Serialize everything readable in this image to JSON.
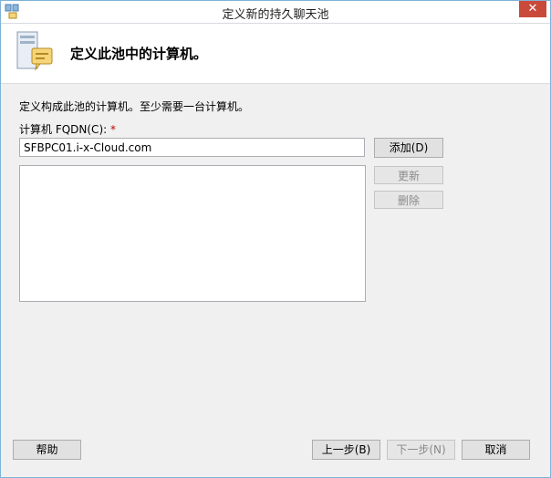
{
  "window": {
    "title": "定义新的持久聊天池",
    "close_glyph": "✕"
  },
  "header": {
    "title": "定义此池中的计算机。"
  },
  "form": {
    "description": "定义构成此池的计算机。至少需要一台计算机。",
    "fqdn_label": "计算机 FQDN(C):",
    "required_mark": "*",
    "fqdn_value": "SFBPC01.i-x-Cloud.com",
    "computers": []
  },
  "buttons": {
    "add": "添加(D)",
    "update": "更新",
    "delete": "删除",
    "help": "帮助",
    "prev": "上一步(B)",
    "next": "下一步(N)",
    "cancel": "取消"
  },
  "colors": {
    "close_button": "#c94a3a",
    "required": "#c00000"
  }
}
